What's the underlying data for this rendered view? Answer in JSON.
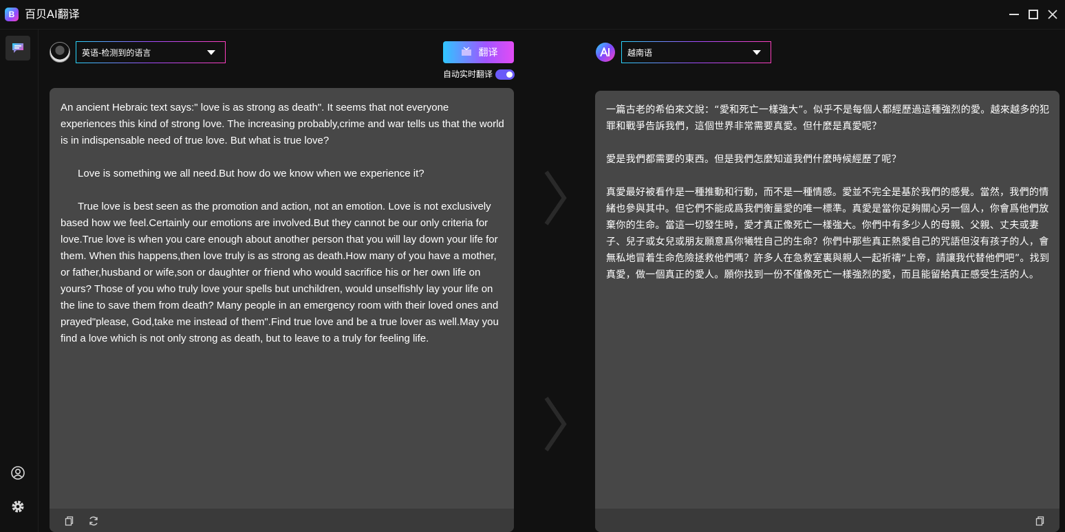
{
  "window": {
    "title": "百贝AI翻译",
    "logo_letter": "B"
  },
  "source": {
    "language": "英语-检测到的语言",
    "text": "An ancient Hebraic text says:\" love is as strong as death\". It seems that not everyone experiences this kind of strong love. The increasing probably,crime and war tells us that the world is in indispensable need of true love. But what is true love?\n\n      Love is something we all need.But how do we know when we experience it?\n\n      True love is best seen as the promotion and action, not an emotion. Love is not exclusively based how we feel.Certainly our emotions are involved.But they cannot be our only criteria for love.True love is when you care enough about another person that you will lay down your life for them. When this happens,then love truly is as strong as death.How many of you have a mother, or father,husband or wife,son or daughter or friend who would sacrifice his or her own life on yours? Those of you who truly love your spells but unchildren, would unselfishly lay your life on the line to save them from death? Many people in an emergency room with their loved ones and prayed\"please, God,take me instead of them\".Find true love and be a true lover as well.May you find a love which is not only strong as death, but to leave to a truly for feeling life."
  },
  "toolbar": {
    "translate_label": "翻译",
    "auto_translate_label": "自动实时翻译",
    "auto_translate_on": true
  },
  "target": {
    "language": "越南语",
    "text": "一篇古老的希伯來文說：“愛和死亡一樣強大”。似乎不是每個人都經歷過這種強烈的愛。越來越多的犯罪和戰爭告訴我們，這個世界非常需要真愛。但什麼是真愛呢？\n\n愛是我們都需要的東西。但是我們怎麼知道我們什麼時候經歷了呢？\n\n真愛最好被看作是一種推動和行動，而不是一種情感。愛並不完全是基於我們的感覺。當然，我們的情緒也參與其中。但它們不能成爲我們衡量愛的唯一標準。真愛是當你足夠關心另一個人，你會爲他們放棄你的生命。當這一切發生時，愛才真正像死亡一樣強大。你們中有多少人的母親、父親、丈夫或妻子、兒子或女兒或朋友願意爲你犧牲自己的生命？你們中那些真正熱愛自己的咒語但沒有孩子的人，會無私地冒着生命危險拯救他們嗎？許多人在急救室裏與親人一起祈禱“上帝，請讓我代替他們吧”。找到真愛，做一個真正的愛人。願你找到一份不僅像死亡一樣強烈的愛，而且能留給真正感受生活的人。"
  },
  "icons": {
    "sidebar_top": "chat-translate-icon",
    "sidebar_user": "user-icon",
    "sidebar_settings": "gear-icon",
    "source_copy": "copy-icon",
    "source_refresh": "refresh-icon",
    "target_copy": "copy-icon"
  },
  "colors": {
    "background": "#111111",
    "panel": "#474747",
    "accent_start": "#2fc6ff",
    "accent_end": "#e24cf5",
    "toggle": "#6a5af9"
  }
}
